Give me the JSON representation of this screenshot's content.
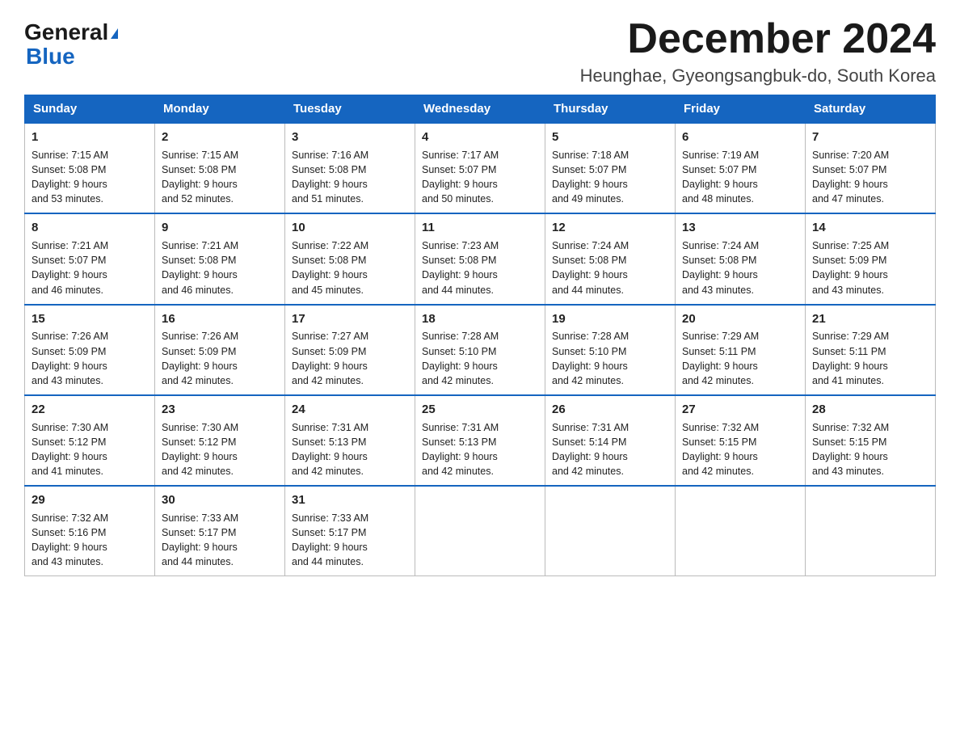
{
  "logo": {
    "general": "General",
    "triangle": "▶",
    "blue": "Blue"
  },
  "title": {
    "month": "December 2024",
    "location": "Heunghae, Gyeongsangbuk-do, South Korea"
  },
  "days": [
    "Sunday",
    "Monday",
    "Tuesday",
    "Wednesday",
    "Thursday",
    "Friday",
    "Saturday"
  ],
  "weeks": [
    [
      {
        "day": "1",
        "sunrise": "7:15 AM",
        "sunset": "5:08 PM",
        "daylight": "9 hours and 53 minutes."
      },
      {
        "day": "2",
        "sunrise": "7:15 AM",
        "sunset": "5:08 PM",
        "daylight": "9 hours and 52 minutes."
      },
      {
        "day": "3",
        "sunrise": "7:16 AM",
        "sunset": "5:08 PM",
        "daylight": "9 hours and 51 minutes."
      },
      {
        "day": "4",
        "sunrise": "7:17 AM",
        "sunset": "5:07 PM",
        "daylight": "9 hours and 50 minutes."
      },
      {
        "day": "5",
        "sunrise": "7:18 AM",
        "sunset": "5:07 PM",
        "daylight": "9 hours and 49 minutes."
      },
      {
        "day": "6",
        "sunrise": "7:19 AM",
        "sunset": "5:07 PM",
        "daylight": "9 hours and 48 minutes."
      },
      {
        "day": "7",
        "sunrise": "7:20 AM",
        "sunset": "5:07 PM",
        "daylight": "9 hours and 47 minutes."
      }
    ],
    [
      {
        "day": "8",
        "sunrise": "7:21 AM",
        "sunset": "5:07 PM",
        "daylight": "9 hours and 46 minutes."
      },
      {
        "day": "9",
        "sunrise": "7:21 AM",
        "sunset": "5:08 PM",
        "daylight": "9 hours and 46 minutes."
      },
      {
        "day": "10",
        "sunrise": "7:22 AM",
        "sunset": "5:08 PM",
        "daylight": "9 hours and 45 minutes."
      },
      {
        "day": "11",
        "sunrise": "7:23 AM",
        "sunset": "5:08 PM",
        "daylight": "9 hours and 44 minutes."
      },
      {
        "day": "12",
        "sunrise": "7:24 AM",
        "sunset": "5:08 PM",
        "daylight": "9 hours and 44 minutes."
      },
      {
        "day": "13",
        "sunrise": "7:24 AM",
        "sunset": "5:08 PM",
        "daylight": "9 hours and 43 minutes."
      },
      {
        "day": "14",
        "sunrise": "7:25 AM",
        "sunset": "5:09 PM",
        "daylight": "9 hours and 43 minutes."
      }
    ],
    [
      {
        "day": "15",
        "sunrise": "7:26 AM",
        "sunset": "5:09 PM",
        "daylight": "9 hours and 43 minutes."
      },
      {
        "day": "16",
        "sunrise": "7:26 AM",
        "sunset": "5:09 PM",
        "daylight": "9 hours and 42 minutes."
      },
      {
        "day": "17",
        "sunrise": "7:27 AM",
        "sunset": "5:09 PM",
        "daylight": "9 hours and 42 minutes."
      },
      {
        "day": "18",
        "sunrise": "7:28 AM",
        "sunset": "5:10 PM",
        "daylight": "9 hours and 42 minutes."
      },
      {
        "day": "19",
        "sunrise": "7:28 AM",
        "sunset": "5:10 PM",
        "daylight": "9 hours and 42 minutes."
      },
      {
        "day": "20",
        "sunrise": "7:29 AM",
        "sunset": "5:11 PM",
        "daylight": "9 hours and 42 minutes."
      },
      {
        "day": "21",
        "sunrise": "7:29 AM",
        "sunset": "5:11 PM",
        "daylight": "9 hours and 41 minutes."
      }
    ],
    [
      {
        "day": "22",
        "sunrise": "7:30 AM",
        "sunset": "5:12 PM",
        "daylight": "9 hours and 41 minutes."
      },
      {
        "day": "23",
        "sunrise": "7:30 AM",
        "sunset": "5:12 PM",
        "daylight": "9 hours and 42 minutes."
      },
      {
        "day": "24",
        "sunrise": "7:31 AM",
        "sunset": "5:13 PM",
        "daylight": "9 hours and 42 minutes."
      },
      {
        "day": "25",
        "sunrise": "7:31 AM",
        "sunset": "5:13 PM",
        "daylight": "9 hours and 42 minutes."
      },
      {
        "day": "26",
        "sunrise": "7:31 AM",
        "sunset": "5:14 PM",
        "daylight": "9 hours and 42 minutes."
      },
      {
        "day": "27",
        "sunrise": "7:32 AM",
        "sunset": "5:15 PM",
        "daylight": "9 hours and 42 minutes."
      },
      {
        "day": "28",
        "sunrise": "7:32 AM",
        "sunset": "5:15 PM",
        "daylight": "9 hours and 43 minutes."
      }
    ],
    [
      {
        "day": "29",
        "sunrise": "7:32 AM",
        "sunset": "5:16 PM",
        "daylight": "9 hours and 43 minutes."
      },
      {
        "day": "30",
        "sunrise": "7:33 AM",
        "sunset": "5:17 PM",
        "daylight": "9 hours and 44 minutes."
      },
      {
        "day": "31",
        "sunrise": "7:33 AM",
        "sunset": "5:17 PM",
        "daylight": "9 hours and 44 minutes."
      },
      null,
      null,
      null,
      null
    ]
  ]
}
